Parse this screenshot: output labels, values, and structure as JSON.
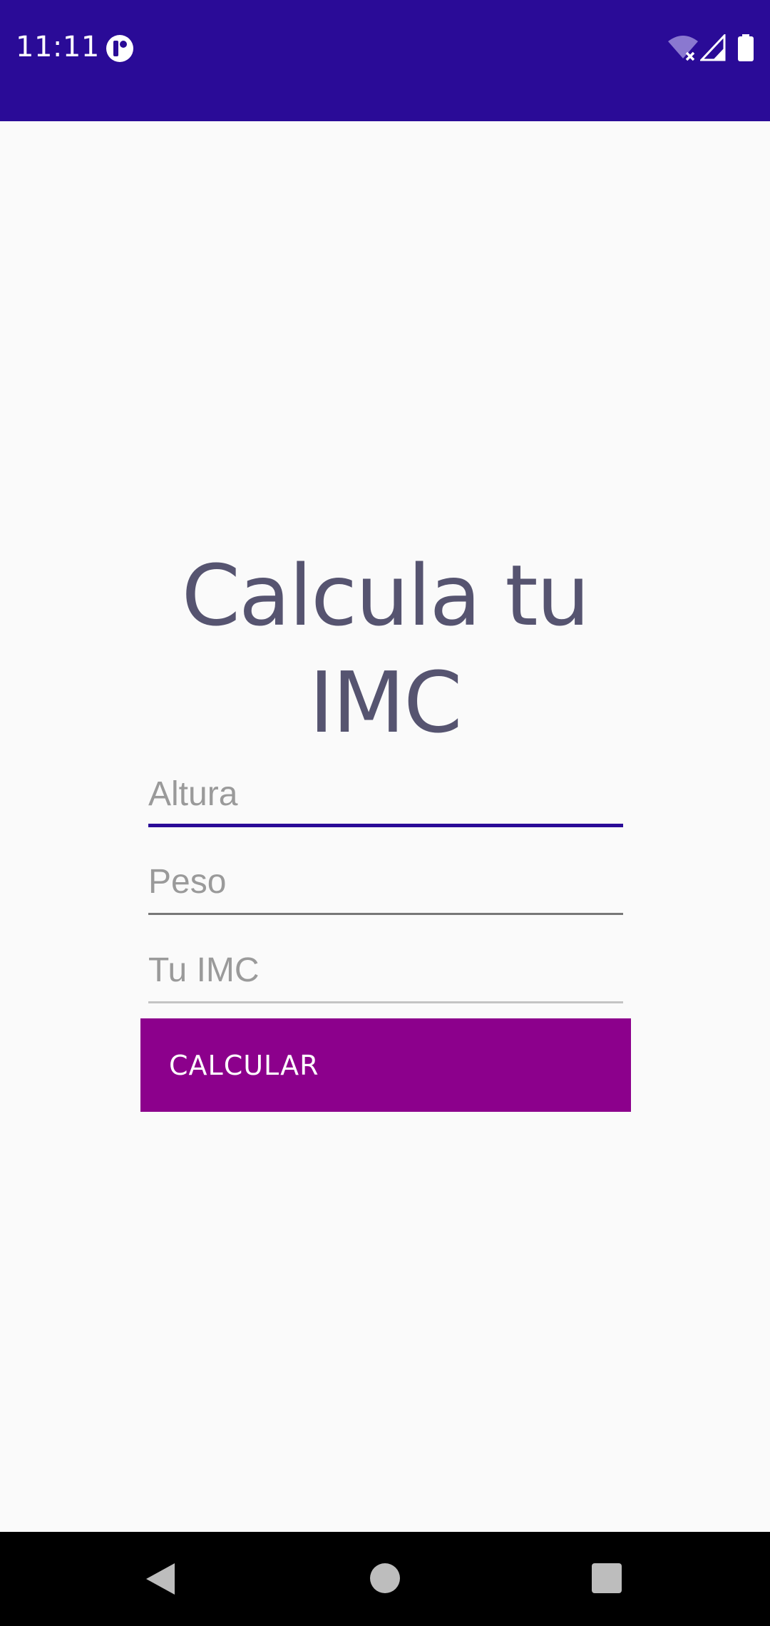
{
  "status_bar": {
    "time": "11:11",
    "icons": [
      "app-notification-icon",
      "wifi-off-icon",
      "cell-signal-icon",
      "battery-icon"
    ]
  },
  "title": {
    "line1": "Calcula tu",
    "line2": "IMC"
  },
  "form": {
    "altura_placeholder": "Altura",
    "peso_placeholder": "Peso",
    "imc_placeholder": "Tu IMC",
    "altura_value": "",
    "peso_value": "",
    "imc_value": ""
  },
  "button": {
    "label": "CALCULAR"
  },
  "nav": {
    "icons": [
      "back-icon",
      "home-icon",
      "recents-icon"
    ]
  },
  "colors": {
    "status_bar": "#2a0b97",
    "title": "#565470",
    "button": "#8c008c",
    "focus_underline": "#2a0b97",
    "background": "#fafafa"
  }
}
